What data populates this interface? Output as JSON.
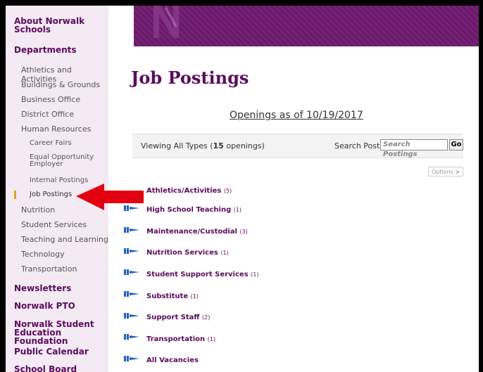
{
  "sidebar": {
    "about": "About Norwalk Schools",
    "departments": "Departments",
    "dept_items": [
      "Athletics and Activities",
      "Buildings & Grounds",
      "Business Office",
      "District Office",
      "Human Resources"
    ],
    "hr_items": [
      "Career Fairs",
      "Equal Opportunity Employer",
      "Internal Postings",
      "Job Postings"
    ],
    "dept_items_after": [
      "Nutrition",
      "Student Services",
      "Teaching and Learning",
      "Technology",
      "Transportation"
    ],
    "bottom_items": [
      "Newsletters",
      "Norwalk PTO",
      "Norwalk Student Education Foundation",
      "Public Calendar",
      "School Board"
    ]
  },
  "main": {
    "title": "Job Postings",
    "openings_as_of": "Openings as of 10/19/2017",
    "filter_prefix": "Viewing All Types (",
    "filter_count": "15",
    "filter_suffix": " openings)",
    "search_label": "Search Postings:",
    "search_placeholder": "Search Postings",
    "go_label": "Go",
    "options_label": "Options ≽"
  },
  "categories": [
    {
      "name": "Athletics/Activities",
      "count": "(5)"
    },
    {
      "name": "High School Teaching",
      "count": "(1)"
    },
    {
      "name": "Maintenance/Custodial",
      "count": "(3)"
    },
    {
      "name": "Nutrition Services",
      "count": "(1)"
    },
    {
      "name": "Student Support Services",
      "count": "(1)"
    },
    {
      "name": "Substitute",
      "count": "(1)"
    },
    {
      "name": "Support Staff",
      "count": "(2)"
    },
    {
      "name": "Transportation",
      "count": "(1)"
    },
    {
      "name": "All Vacancies",
      "count": ""
    }
  ],
  "colors": {
    "brand_purple": "#5b0b5d",
    "banner": "#6e1a6e",
    "sidebar_bg": "#f3eaf3",
    "arrow": "#e3000f",
    "active_marker": "#e0a020"
  }
}
